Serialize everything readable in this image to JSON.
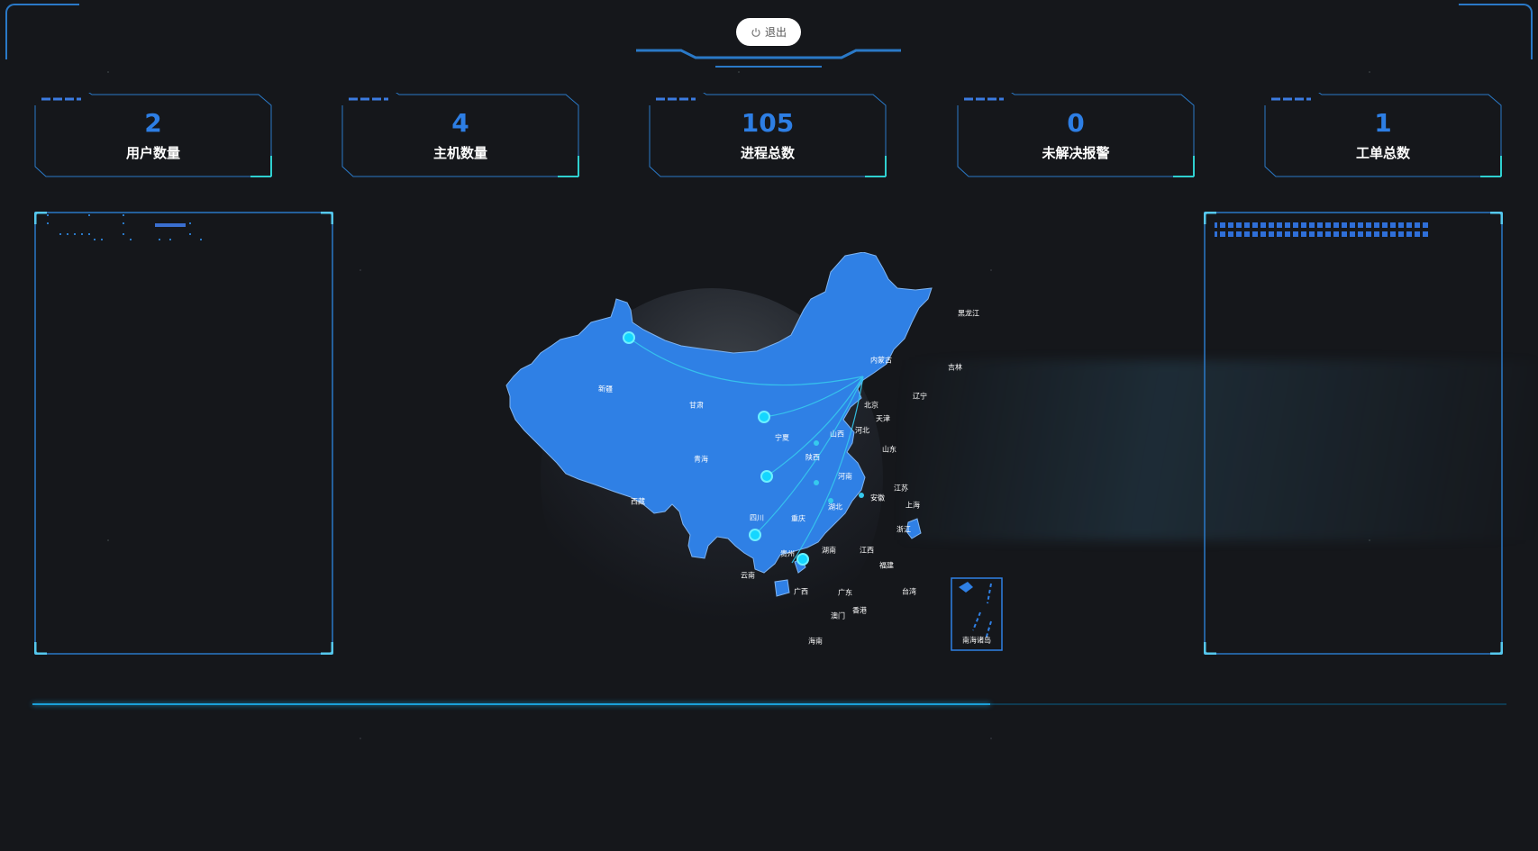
{
  "header": {
    "logout_label": "退出"
  },
  "stats": [
    {
      "value": "2",
      "label": "用户数量"
    },
    {
      "value": "4",
      "label": "主机数量"
    },
    {
      "value": "105",
      "label": "进程总数"
    },
    {
      "value": "0",
      "label": "未解决报警"
    },
    {
      "value": "1",
      "label": "工单总数"
    }
  ],
  "map": {
    "provinces": {
      "xinjiang": "新疆",
      "gansu": "甘肃",
      "qinghai": "青海",
      "xizang": "西藏",
      "neimenggu": "内蒙古",
      "heilongjiang": "黑龙江",
      "jilin": "吉林",
      "liaoning": "辽宁",
      "beijing": "北京",
      "tianjin": "天津",
      "hebei": "河北",
      "shanxi": "山西",
      "ningxia": "宁夏",
      "shaanxi": "陕西",
      "shandong": "山东",
      "henan": "河南",
      "jiangsu": "江苏",
      "anhui": "安徽",
      "shanghai": "上海",
      "hubei": "湖北",
      "sichuan": "四川",
      "chongqing": "重庆",
      "zhejiang": "浙江",
      "hunan": "湖南",
      "jiangxi": "江西",
      "guizhou": "贵州",
      "yunnan": "云南",
      "fujian": "福建",
      "guangxi": "广西",
      "guangdong": "广东",
      "taiwan": "台湾",
      "xianggang": "香港",
      "aomen": "澳门",
      "hainan": "海南",
      "nanhai": "南海诸岛"
    }
  },
  "progress": {
    "fraction": 0.65
  },
  "colors": {
    "accent": "#2d7ee4",
    "map_fill": "#2f80e5",
    "frame": "#2a79c7",
    "line": "#1b9fd8",
    "background": "#15171b"
  }
}
